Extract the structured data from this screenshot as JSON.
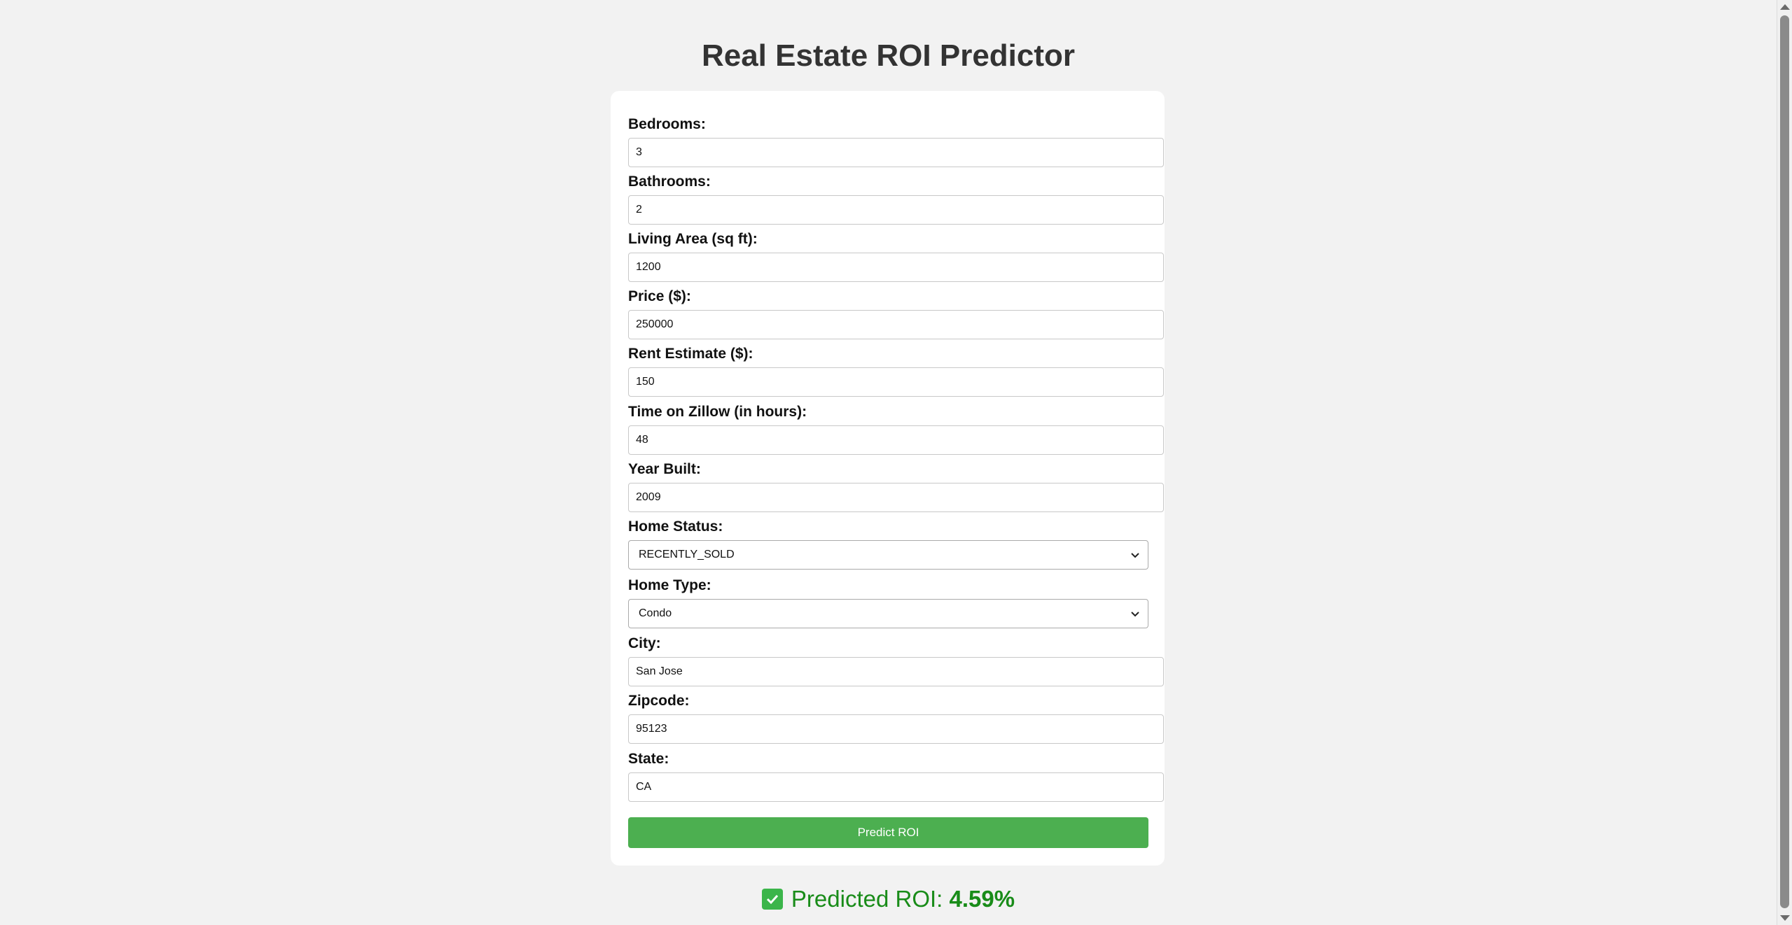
{
  "page": {
    "title": "Real Estate ROI Predictor"
  },
  "form": {
    "bedrooms": {
      "label": "Bedrooms:",
      "value": "3"
    },
    "bathrooms": {
      "label": "Bathrooms:",
      "value": "2"
    },
    "living_area": {
      "label": "Living Area (sq ft):",
      "value": "1200"
    },
    "price": {
      "label": "Price ($):",
      "value": "250000"
    },
    "rent_estimate": {
      "label": "Rent Estimate ($):",
      "value": "150"
    },
    "time_on_zillow": {
      "label": "Time on Zillow (in hours):",
      "value": "48"
    },
    "year_built": {
      "label": "Year Built:",
      "value": "2009"
    },
    "home_status": {
      "label": "Home Status:",
      "value": "RECENTLY_SOLD"
    },
    "home_type": {
      "label": "Home Type:",
      "value": "Condo"
    },
    "city": {
      "label": "City:",
      "value": "San Jose"
    },
    "zipcode": {
      "label": "Zipcode:",
      "value": "95123"
    },
    "state": {
      "label": "State:",
      "value": "CA"
    },
    "submit_label": "Predict ROI"
  },
  "result": {
    "label": "Predicted ROI:",
    "value": "4.59%",
    "icon": "check-box-icon"
  },
  "colors": {
    "background": "#f2f2f2",
    "card": "#ffffff",
    "button": "#4caf50",
    "result_text": "#198c19",
    "title": "#333333"
  }
}
